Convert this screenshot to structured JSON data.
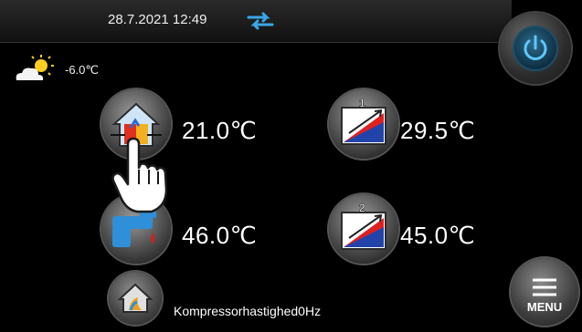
{
  "header": {
    "datetime": "28.7.2021 12:49",
    "sync_icon": "sync-arrows-icon"
  },
  "weather": {
    "icon": "partly-sunny-icon",
    "outdoor_temp": "-6.0℃"
  },
  "tiles": [
    {
      "id": "room",
      "icon": "house-thermometer-icon",
      "value": "21.0℃"
    },
    {
      "id": "circuit1",
      "icon": "heating-circuit-1-icon",
      "badge": "1",
      "value": "29.5℃"
    },
    {
      "id": "hotwater",
      "icon": "faucet-icon",
      "value": "46.0℃"
    },
    {
      "id": "circuit2",
      "icon": "heating-circuit-2-icon",
      "badge": "2",
      "value": "45.0℃"
    }
  ],
  "status": {
    "icon": "heat-pump-house-icon",
    "text": "Kompressorhastighed0Hz"
  },
  "menu": {
    "label": "MENU"
  },
  "colors": {
    "accent_blue": "#3aa7e8",
    "red": "#d32020",
    "topbar": "#1c1c1c"
  }
}
